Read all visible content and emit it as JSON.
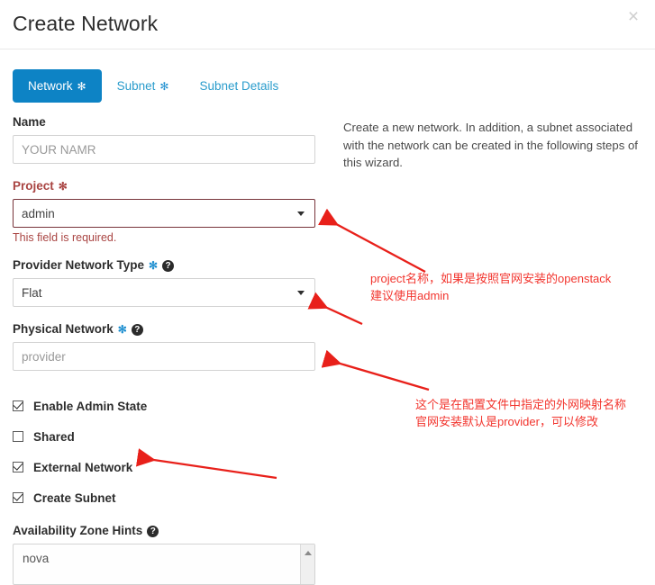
{
  "modal": {
    "title": "Create Network",
    "close_label": "×"
  },
  "tabs": [
    {
      "label": "Network",
      "required": true,
      "active": true
    },
    {
      "label": "Subnet",
      "required": true,
      "active": false
    },
    {
      "label": "Subnet Details",
      "required": false,
      "active": false
    }
  ],
  "form": {
    "name": {
      "label": "Name",
      "placeholder": "YOUR NAMR",
      "value": ""
    },
    "project": {
      "label": "Project",
      "required_mark": "✻",
      "value": "admin",
      "error": "This field is required."
    },
    "provider_network_type": {
      "label": "Provider Network Type",
      "required_mark": "✻",
      "help": "?",
      "value": "Flat"
    },
    "physical_network": {
      "label": "Physical Network",
      "required_mark": "✻",
      "help": "?",
      "placeholder": "provider",
      "value": ""
    },
    "checkboxes": [
      {
        "label": "Enable Admin State",
        "checked": true
      },
      {
        "label": "Shared",
        "checked": false
      },
      {
        "label": "External Network",
        "checked": true
      },
      {
        "label": "Create Subnet",
        "checked": true
      }
    ],
    "availability_zone_hints": {
      "label": "Availability Zone Hints",
      "help": "?",
      "items": [
        "nova"
      ]
    }
  },
  "description": "Create a new network. In addition, a subnet associated with the network can be created in the following steps of this wizard.",
  "annotations": [
    {
      "id": "anno-project",
      "text": "project名称，如果是按照官网安装的openstack\n建议使用admin"
    },
    {
      "id": "anno-physical",
      "text": "这个是在配置文件中指定的外网映射名称\n官网安装默认是provider，可以修改"
    }
  ],
  "colors": {
    "accent_blue": "#0d83c5",
    "link_blue": "#2a9ccc",
    "error_red": "#a94442",
    "annotation_red": "#f2352e",
    "field_border": "#d3d3d3"
  }
}
